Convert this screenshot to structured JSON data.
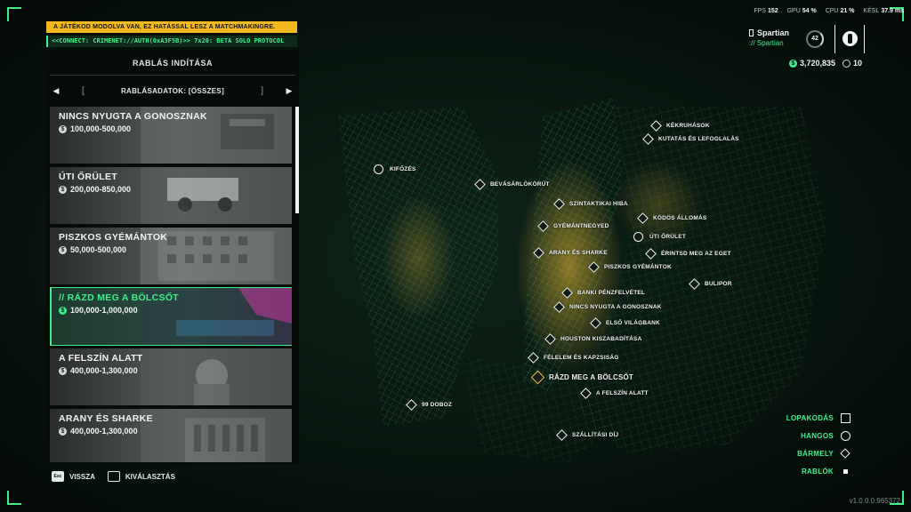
{
  "warning_banner": "A JÁTÉKOD MODOLVA VAN, EZ HATÁSSAL LESZ A MATCHMAKINGRE.",
  "connect_banner": "<<CONNECT: CRIMENET://AUTH(0xA3F5B)>> 7x20: BETA SOLO PROTOCOL",
  "panel": {
    "title": "RABLÁS INDÍTÁSA",
    "filter_label": "RABLÁSADATOK: [ÖSSZES]",
    "prev_arrow": "◀",
    "next_arrow": "▶",
    "bracket_left": "[",
    "bracket_right": "]",
    "heists": [
      {
        "name": "NINCS NYUGTA A GONOSZNAK",
        "price": "100,000-500,000"
      },
      {
        "name": "ÚTI ŐRÜLET",
        "price": "200,000-850,000"
      },
      {
        "name": "PISZKOS GYÉMÁNTOK",
        "price": "50,000-500,000"
      },
      {
        "name": "// RÁZD MEG A BÖLCSŐT",
        "price": "100,000-1,000,000"
      },
      {
        "name": "A FELSZÍN ALATT",
        "price": "400,000-1,300,000"
      },
      {
        "name": "ARANY ÉS SHARKE",
        "price": "400,000-1,300,000"
      }
    ],
    "coin_symbol": "$"
  },
  "controls": {
    "back_key": "Esc",
    "back_label": "VISSZA",
    "select_label": "KIVÁLASZTÁS"
  },
  "perf": {
    "fps_label": "FPS",
    "fps": "152",
    "gpu_label": "GPU",
    "gpu": "54 %",
    "cpu_label": "CPU",
    "cpu": "21 %",
    "lat_label": "KÉSL",
    "lat": "37.9 ms"
  },
  "profile": {
    "name": "Spartian",
    "crew": ":// Spartian",
    "level": "42",
    "money": "3,720,835",
    "tokens": "10"
  },
  "map_markers": [
    {
      "label": "KÉKRUHÁSOK",
      "type": "diamond"
    },
    {
      "label": "KUTATÁS ÉS LEFOGLALÁS",
      "type": "diamond"
    },
    {
      "label": "KIFŐZÉS",
      "type": "circle"
    },
    {
      "label": "BEVÁSÁRLÓKÖRÚT",
      "type": "diamond"
    },
    {
      "label": "SZINTAKTIKAI HIBA",
      "type": "diamond"
    },
    {
      "label": "KÖDÖS ÁLLOMÁS",
      "type": "diamond"
    },
    {
      "label": "GYÉMÁNTNEGYED",
      "type": "diamond"
    },
    {
      "label": "ÚTI ŐRÜLET",
      "type": "circle"
    },
    {
      "label": "ARANY ÉS SHARKE",
      "type": "diamond"
    },
    {
      "label": "ÉRINTSD MEG AZ EGET",
      "type": "diamond"
    },
    {
      "label": "PISZKOS GYÉMÁNTOK",
      "type": "diamond"
    },
    {
      "label": "BULIPOR",
      "type": "diamond"
    },
    {
      "label": "BANKI PÉNZFELVÉTEL",
      "type": "diamond"
    },
    {
      "label": "NINCS NYUGTA A GONOSZNAK",
      "type": "diamond"
    },
    {
      "label": "ELSŐ VILÁGBANK",
      "type": "diamond"
    },
    {
      "label": "HOUSTON KISZABADÍTÁSA",
      "type": "diamond"
    },
    {
      "label": "FÉLELEM ÉS KAPZSISÁG",
      "type": "diamond"
    },
    {
      "label": "RÁZD MEG A BÖLCSŐT",
      "type": "diamond-gold"
    },
    {
      "label": "A FELSZÍN ALATT",
      "type": "diamond"
    },
    {
      "label": "99 DOBOZ",
      "type": "diamond"
    },
    {
      "label": "SZÁLLÍTÁSI DÍJ",
      "type": "diamond"
    }
  ],
  "legend": [
    {
      "label": "LOPAKODÁS",
      "symbol": "square"
    },
    {
      "label": "HANGOS",
      "symbol": "circle"
    },
    {
      "label": "BÁRMELY",
      "symbol": "diamond"
    },
    {
      "label": "RABLÓK",
      "symbol": "dot"
    }
  ],
  "version": "v1.0.0.0.965372",
  "colors": {
    "accent": "#3ef08a",
    "warning": "#f2b81f",
    "background": "#06100b"
  }
}
